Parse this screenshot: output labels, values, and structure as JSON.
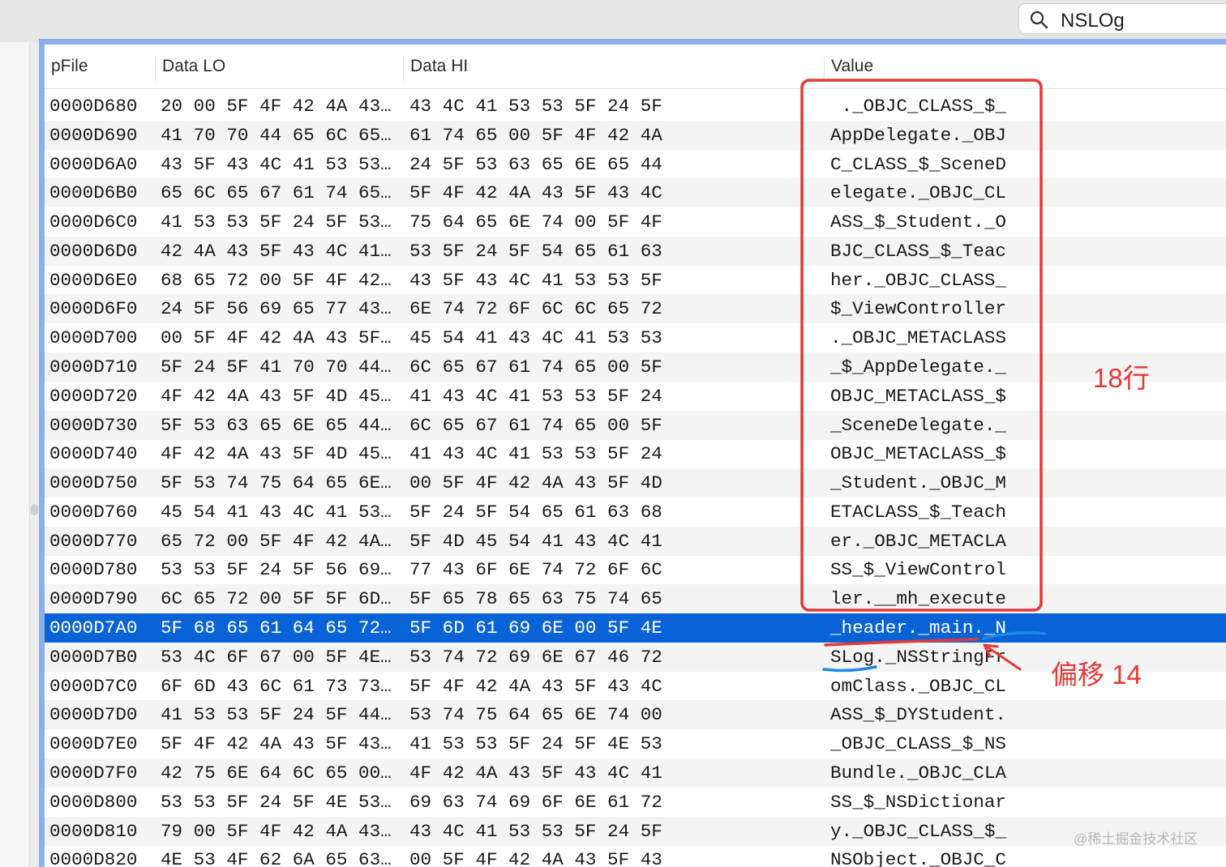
{
  "search": {
    "value": "NSLOg"
  },
  "columns": {
    "pfile": "pFile",
    "data_lo": "Data LO",
    "data_hi": "Data HI",
    "value": "Value"
  },
  "rows": [
    {
      "pfile": "0000D680",
      "lo": "20 00 5F 4F 42 4A 43…",
      "hi": "43 4C 41 53 53 5F 24 5F",
      "value": " ._OBJC_CLASS_$_"
    },
    {
      "pfile": "0000D690",
      "lo": "41 70 70 44 65 6C 65…",
      "hi": "61 74 65 00 5F 4F 42 4A",
      "value": "AppDelegate._OBJ"
    },
    {
      "pfile": "0000D6A0",
      "lo": "43 5F 43 4C 41 53 53…",
      "hi": "24 5F 53 63 65 6E 65 44",
      "value": "C_CLASS_$_SceneD"
    },
    {
      "pfile": "0000D6B0",
      "lo": "65 6C 65 67 61 74 65…",
      "hi": "5F 4F 42 4A 43 5F 43 4C",
      "value": "elegate._OBJC_CL"
    },
    {
      "pfile": "0000D6C0",
      "lo": "41 53 53 5F 24 5F 53…",
      "hi": "75 64 65 6E 74 00 5F 4F",
      "value": "ASS_$_Student._O"
    },
    {
      "pfile": "0000D6D0",
      "lo": "42 4A 43 5F 43 4C 41…",
      "hi": "53 5F 24 5F 54 65 61 63",
      "value": "BJC_CLASS_$_Teac"
    },
    {
      "pfile": "0000D6E0",
      "lo": "68 65 72 00 5F 4F 42…",
      "hi": "43 5F 43 4C 41 53 53 5F",
      "value": "her._OBJC_CLASS_"
    },
    {
      "pfile": "0000D6F0",
      "lo": "24 5F 56 69 65 77 43…",
      "hi": "6E 74 72 6F 6C 6C 65 72",
      "value": "$_ViewController"
    },
    {
      "pfile": "0000D700",
      "lo": "00 5F 4F 42 4A 43 5F…",
      "hi": "45 54 41 43 4C 41 53 53",
      "value": "._OBJC_METACLASS"
    },
    {
      "pfile": "0000D710",
      "lo": "5F 24 5F 41 70 70 44…",
      "hi": "6C 65 67 61 74 65 00 5F",
      "value": "_$_AppDelegate._"
    },
    {
      "pfile": "0000D720",
      "lo": "4F 42 4A 43 5F 4D 45…",
      "hi": "41 43 4C 41 53 53 5F 24",
      "value": "OBJC_METACLASS_$"
    },
    {
      "pfile": "0000D730",
      "lo": "5F 53 63 65 6E 65 44…",
      "hi": "6C 65 67 61 74 65 00 5F",
      "value": "_SceneDelegate._"
    },
    {
      "pfile": "0000D740",
      "lo": "4F 42 4A 43 5F 4D 45…",
      "hi": "41 43 4C 41 53 53 5F 24",
      "value": "OBJC_METACLASS_$"
    },
    {
      "pfile": "0000D750",
      "lo": "5F 53 74 75 64 65 6E…",
      "hi": "00 5F 4F 42 4A 43 5F 4D",
      "value": "_Student._OBJC_M"
    },
    {
      "pfile": "0000D760",
      "lo": "45 54 41 43 4C 41 53…",
      "hi": "5F 24 5F 54 65 61 63 68",
      "value": "ETACLASS_$_Teach"
    },
    {
      "pfile": "0000D770",
      "lo": "65 72 00 5F 4F 42 4A…",
      "hi": "5F 4D 45 54 41 43 4C 41",
      "value": "er._OBJC_METACLA"
    },
    {
      "pfile": "0000D780",
      "lo": "53 53 5F 24 5F 56 69…",
      "hi": "77 43 6F 6E 74 72 6F 6C",
      "value": "SS_$_ViewControl"
    },
    {
      "pfile": "0000D790",
      "lo": "6C 65 72 00 5F 5F 6D…",
      "hi": "5F 65 78 65 63 75 74 65",
      "value": "ler.__mh_execute"
    },
    {
      "pfile": "0000D7A0",
      "lo": "5F 68 65 61 64 65 72…",
      "hi": "5F 6D 61 69 6E 00 5F 4E",
      "value": "_header._main._N"
    },
    {
      "pfile": "0000D7B0",
      "lo": "53 4C 6F 67 00 5F 4E…",
      "hi": "53 74 72 69 6E 67 46 72",
      "value": "SLog._NSStringFr"
    },
    {
      "pfile": "0000D7C0",
      "lo": "6F 6D 43 6C 61 73 73…",
      "hi": "5F 4F 42 4A 43 5F 43 4C",
      "value": "omClass._OBJC_CL"
    },
    {
      "pfile": "0000D7D0",
      "lo": "41 53 53 5F 24 5F 44…",
      "hi": "53 74 75 64 65 6E 74 00",
      "value": "ASS_$_DYStudent."
    },
    {
      "pfile": "0000D7E0",
      "lo": "5F 4F 42 4A 43 5F 43…",
      "hi": "41 53 53 5F 24 5F 4E 53",
      "value": "_OBJC_CLASS_$_NS"
    },
    {
      "pfile": "0000D7F0",
      "lo": "42 75 6E 64 6C 65 00…",
      "hi": "4F 42 4A 43 5F 43 4C 41",
      "value": "Bundle._OBJC_CLA"
    },
    {
      "pfile": "0000D800",
      "lo": "53 53 5F 24 5F 4E 53…",
      "hi": "69 63 74 69 6F 6E 61 72",
      "value": "SS_$_NSDictionar"
    },
    {
      "pfile": "0000D810",
      "lo": "79 00 5F 4F 42 4A 43…",
      "hi": "43 4C 41 53 53 5F 24 5F",
      "value": "y._OBJC_CLASS_$_"
    },
    {
      "pfile": "0000D820",
      "lo": "4E 53 4F 62 6A 65 63…",
      "hi": "00 5F 4F 42 4A 43 5F 43",
      "value": "NSObject._OBJC_C"
    }
  ],
  "selected_row": 18,
  "annotations": {
    "rows_note": "18行",
    "offset_note": "偏移 14"
  },
  "watermark": "@稀土掘金技术社区",
  "colors": {
    "selection": "#0a63d6",
    "annotation_red": "#e53935",
    "annotation_blue": "#1e88e5",
    "focus_ring": "#8bb0ea"
  }
}
